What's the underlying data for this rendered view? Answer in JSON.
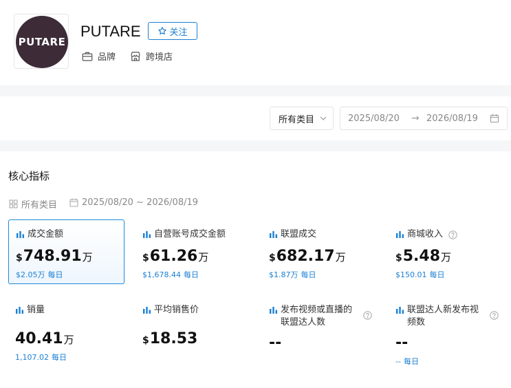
{
  "header": {
    "logo_text": "PUTARE",
    "brand_name": "PUTARE",
    "follow_label": "关注",
    "tags": [
      {
        "label": "品牌",
        "icon": "briefcase-icon"
      },
      {
        "label": "跨境店",
        "icon": "store-icon"
      }
    ],
    "logo_color": "#3d2b38",
    "accent_color": "#1a7fd4"
  },
  "filters": {
    "category": "所有类目",
    "date_start": "2025/08/20",
    "date_arrow": "→",
    "date_end": "2026/08/19"
  },
  "core": {
    "title": "核心指标",
    "meta_category": "所有类目",
    "meta_date": "2025/08/20 ~ 2026/08/19",
    "metrics": [
      {
        "label": "成交金额",
        "currency": "$",
        "value": "748.91",
        "unit": "万",
        "sub_value": "$2.05万",
        "sub_label": "每日",
        "active": true
      },
      {
        "label": "自营账号成交金额",
        "currency": "$",
        "value": "61.26",
        "unit": "万",
        "sub_value": "$1,678.44",
        "sub_label": "每日"
      },
      {
        "label": "联盟成交",
        "currency": "$",
        "value": "682.17",
        "unit": "万",
        "sub_value": "$1.87万",
        "sub_label": "每日"
      },
      {
        "label": "商城收入",
        "currency": "$",
        "value": "5.48",
        "unit": "万",
        "sub_value": "$150.01",
        "sub_label": "每日",
        "help": true
      },
      {
        "label": "销量",
        "currency": "",
        "value": "40.41",
        "unit": "万",
        "sub_value": "1,107.02",
        "sub_label": "每日"
      },
      {
        "label": "平均销售价",
        "currency": "$",
        "value": "18.53",
        "unit": "",
        "sub_value": "",
        "sub_label": ""
      },
      {
        "label": "发布视频或直播的联盟达人数",
        "currency": "",
        "value": "--",
        "unit": "",
        "sub_value": "",
        "sub_label": "",
        "help": true
      },
      {
        "label": "联盟达人新发布视频数",
        "currency": "",
        "value": "--",
        "unit": "",
        "sub_value": "--",
        "sub_label": "每日",
        "help": true
      }
    ]
  }
}
